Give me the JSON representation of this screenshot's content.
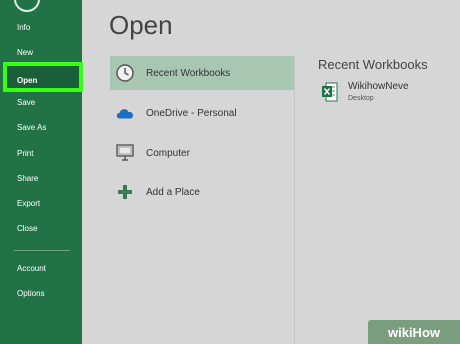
{
  "colors": {
    "sidebar": "#217346",
    "highlight": "#39ff14",
    "selected_row": "#a8c7b2",
    "background": "#d6d6d6"
  },
  "sidebar": {
    "items": [
      {
        "label": "Info",
        "icon": null
      },
      {
        "label": "New"
      },
      {
        "label": "Open"
      },
      {
        "label": "Save"
      },
      {
        "label": "Save As"
      },
      {
        "label": "Print"
      },
      {
        "label": "Share"
      },
      {
        "label": "Export"
      },
      {
        "label": "Close"
      },
      {
        "label": "Account"
      },
      {
        "label": "Options"
      }
    ],
    "active": "Open"
  },
  "main": {
    "title": "Open",
    "locations": [
      {
        "label": "Recent Workbooks",
        "icon": "clock-icon",
        "selected": true
      },
      {
        "label": "OneDrive - Personal",
        "icon": "cloud-icon"
      },
      {
        "label": "Computer",
        "icon": "computer-icon"
      },
      {
        "label": "Add a Place",
        "icon": "plus-icon"
      }
    ],
    "recent": {
      "title": "Recent Workbooks",
      "items": [
        {
          "name": "WikihowNeve",
          "path": "Desktop",
          "icon": "excel-file-icon"
        }
      ]
    }
  },
  "watermark": {
    "text": "wikiHow"
  }
}
